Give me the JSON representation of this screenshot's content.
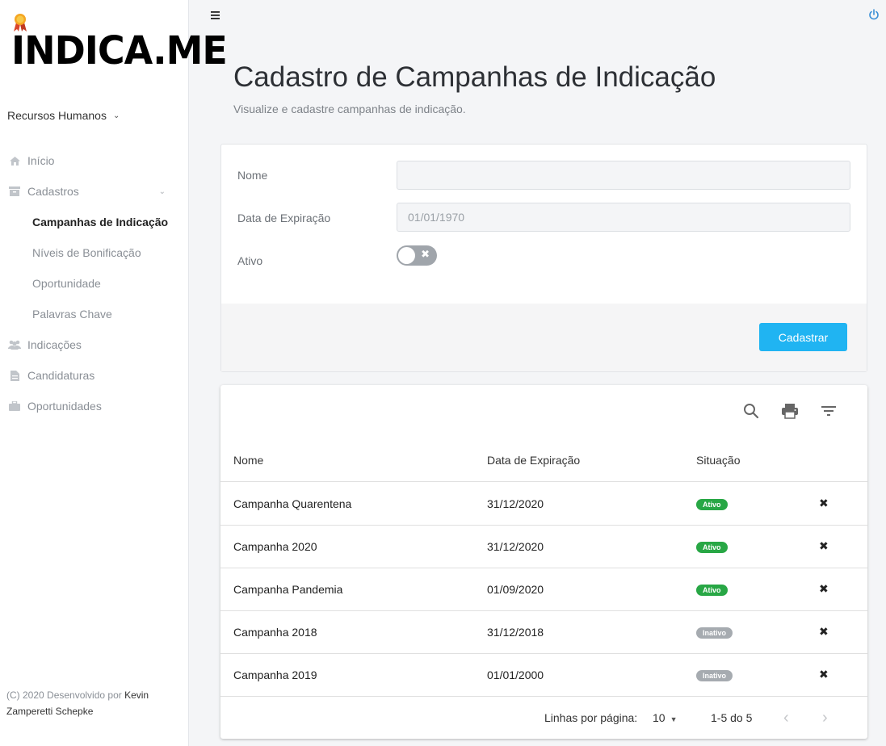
{
  "brand": {
    "logo_text": "INDICA.ME"
  },
  "org_selector": {
    "label": "Recursos Humanos"
  },
  "nav": {
    "inicio": "Início",
    "cadastros": "Cadastros",
    "sub": [
      "Campanhas de Indicação",
      "Níveis de Bonificação",
      "Oportunidade",
      "Palavras Chave"
    ],
    "indicacoes": "Indicações",
    "candidaturas": "Candidaturas",
    "oportunidades": "Oportunidades"
  },
  "footer": {
    "prefix": "(C) 2020 Desenvolvido por ",
    "author_line1": "Kevin",
    "author_line2": "Zamperetti Schepke"
  },
  "page": {
    "title": "Cadastro de Campanhas de Indicação",
    "subtitle": "Visualize e cadastre campanhas de indicação."
  },
  "form": {
    "name_label": "Nome",
    "name_value": "",
    "date_label": "Data de Expiração",
    "date_value": "01/01/1970",
    "active_label": "Ativo",
    "active": false,
    "submit_label": "Cadastrar"
  },
  "table": {
    "headers": [
      "Nome",
      "Data de Expiração",
      "Situação"
    ],
    "rows": [
      {
        "name": "Campanha Quarentena",
        "date": "31/12/2020",
        "status": "Ativo"
      },
      {
        "name": "Campanha 2020",
        "date": "31/12/2020",
        "status": "Ativo"
      },
      {
        "name": "Campanha Pandemia",
        "date": "01/09/2020",
        "status": "Ativo"
      },
      {
        "name": "Campanha 2018",
        "date": "31/12/2018",
        "status": "Inativo"
      },
      {
        "name": "Campanha 2019",
        "date": "01/01/2000",
        "status": "Inativo"
      }
    ],
    "pagination": {
      "rows_per_page_label": "Linhas por página:",
      "rows_per_page": "10",
      "range": "1-5 do 5"
    }
  },
  "colors": {
    "accent": "#20b4f2",
    "active_badge": "#28a745",
    "inactive_badge": "#a6abb0"
  },
  "icons": [
    "menu-icon",
    "power-icon",
    "search-icon",
    "print-icon",
    "filter-icon",
    "home-icon",
    "archive-icon",
    "users-icon",
    "file-icon",
    "briefcase-icon"
  ]
}
